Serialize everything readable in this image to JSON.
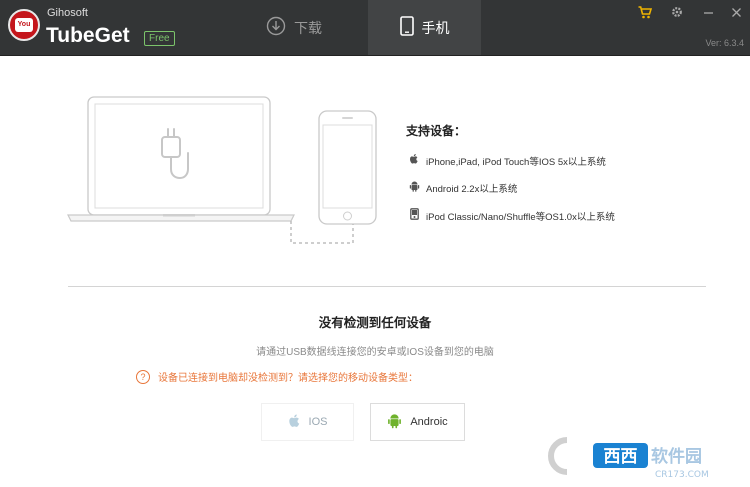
{
  "app": {
    "vendor": "Gihosoft",
    "name": "TubeGet",
    "badge": "Free",
    "version": "Ver: 6.3.4"
  },
  "tabs": [
    {
      "label": "下载"
    },
    {
      "label": "手机"
    }
  ],
  "support": {
    "title": "支持设备：",
    "devices": [
      {
        "icon": "apple-icon",
        "text": "iPhone,iPad, iPod Touch等IOS 5x以上系统"
      },
      {
        "icon": "android-icon",
        "text": "Android 2.2x以上系统"
      },
      {
        "icon": "ipod-icon",
        "text": "iPod Classic/Nano/Shuffle等OS1.0x以上系统"
      }
    ]
  },
  "status": {
    "title": "没有检测到任何设备",
    "hint": "请通过USB数据线连接您的安卓或IOS设备到您的电脑",
    "question": "设备已连接到电脑却没检测到？请选择您的移动设备类型："
  },
  "buttons": {
    "ios": "IOS",
    "android": "Androic"
  },
  "watermark": {
    "text": "西西软件园",
    "url": "CR173.COM"
  },
  "colors": {
    "titlebar": "#333536",
    "accent": "#e8763a",
    "android": "#6fb22c",
    "free": "#7cc46b"
  }
}
